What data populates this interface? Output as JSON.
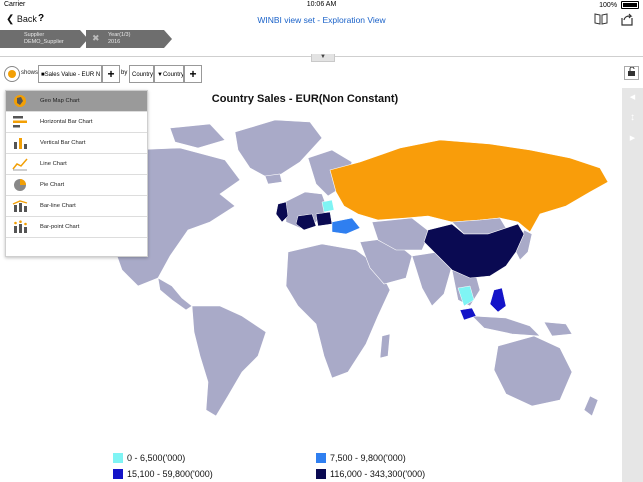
{
  "status_bar": {
    "carrier": "Carrier",
    "time": "10:06 AM",
    "battery": "100%"
  },
  "nav": {
    "back_label": "Back",
    "help_label": "?",
    "title": "WINBI view set - Exploration View"
  },
  "breadcrumbs": [
    {
      "line1": "Supplier",
      "line2": "DEMO_Supplier"
    },
    {
      "line1": "Year(1/3)",
      "line2": "2016"
    }
  ],
  "toolbar": {
    "shows_label": "shows",
    "measure_value": "■Sales Value - EUR N",
    "by_label": "by",
    "dimension_value": "Country",
    "dimension_dropdown_value": "▼Country",
    "add_label": "+"
  },
  "chart_menu": {
    "items": [
      {
        "label": "Geo Map Chart",
        "icon": "geo-map-icon",
        "selected": true
      },
      {
        "label": "Horizontal Bar Chart",
        "icon": "horizontal-bar-icon",
        "selected": false
      },
      {
        "label": "Vertical Bar Chart",
        "icon": "vertical-bar-icon",
        "selected": false
      },
      {
        "label": "Line Chart",
        "icon": "line-chart-icon",
        "selected": false
      },
      {
        "label": "Pie Chart",
        "icon": "pie-chart-icon",
        "selected": false
      },
      {
        "label": "Bar-line Chart",
        "icon": "bar-line-icon",
        "selected": false
      },
      {
        "label": "Bar-point Chart",
        "icon": "bar-point-icon",
        "selected": false
      }
    ]
  },
  "chart": {
    "title": "Country Sales - EUR(Non Constant)"
  },
  "legend": [
    {
      "label": "0 - 6,500('000)",
      "color": "#7ff4f4"
    },
    {
      "label": "7,500 - 9,800('000)",
      "color": "#2f7ff0"
    },
    {
      "label": "15,100 - 59,800('000)",
      "color": "#1414c8"
    },
    {
      "label": "116,000 - 343,300('000)",
      "color": "#0a0a52"
    }
  ],
  "colors": {
    "land": "#a9aac8",
    "highlight_orange": "#f99d0a",
    "accent_blue": "#1a62c9"
  }
}
